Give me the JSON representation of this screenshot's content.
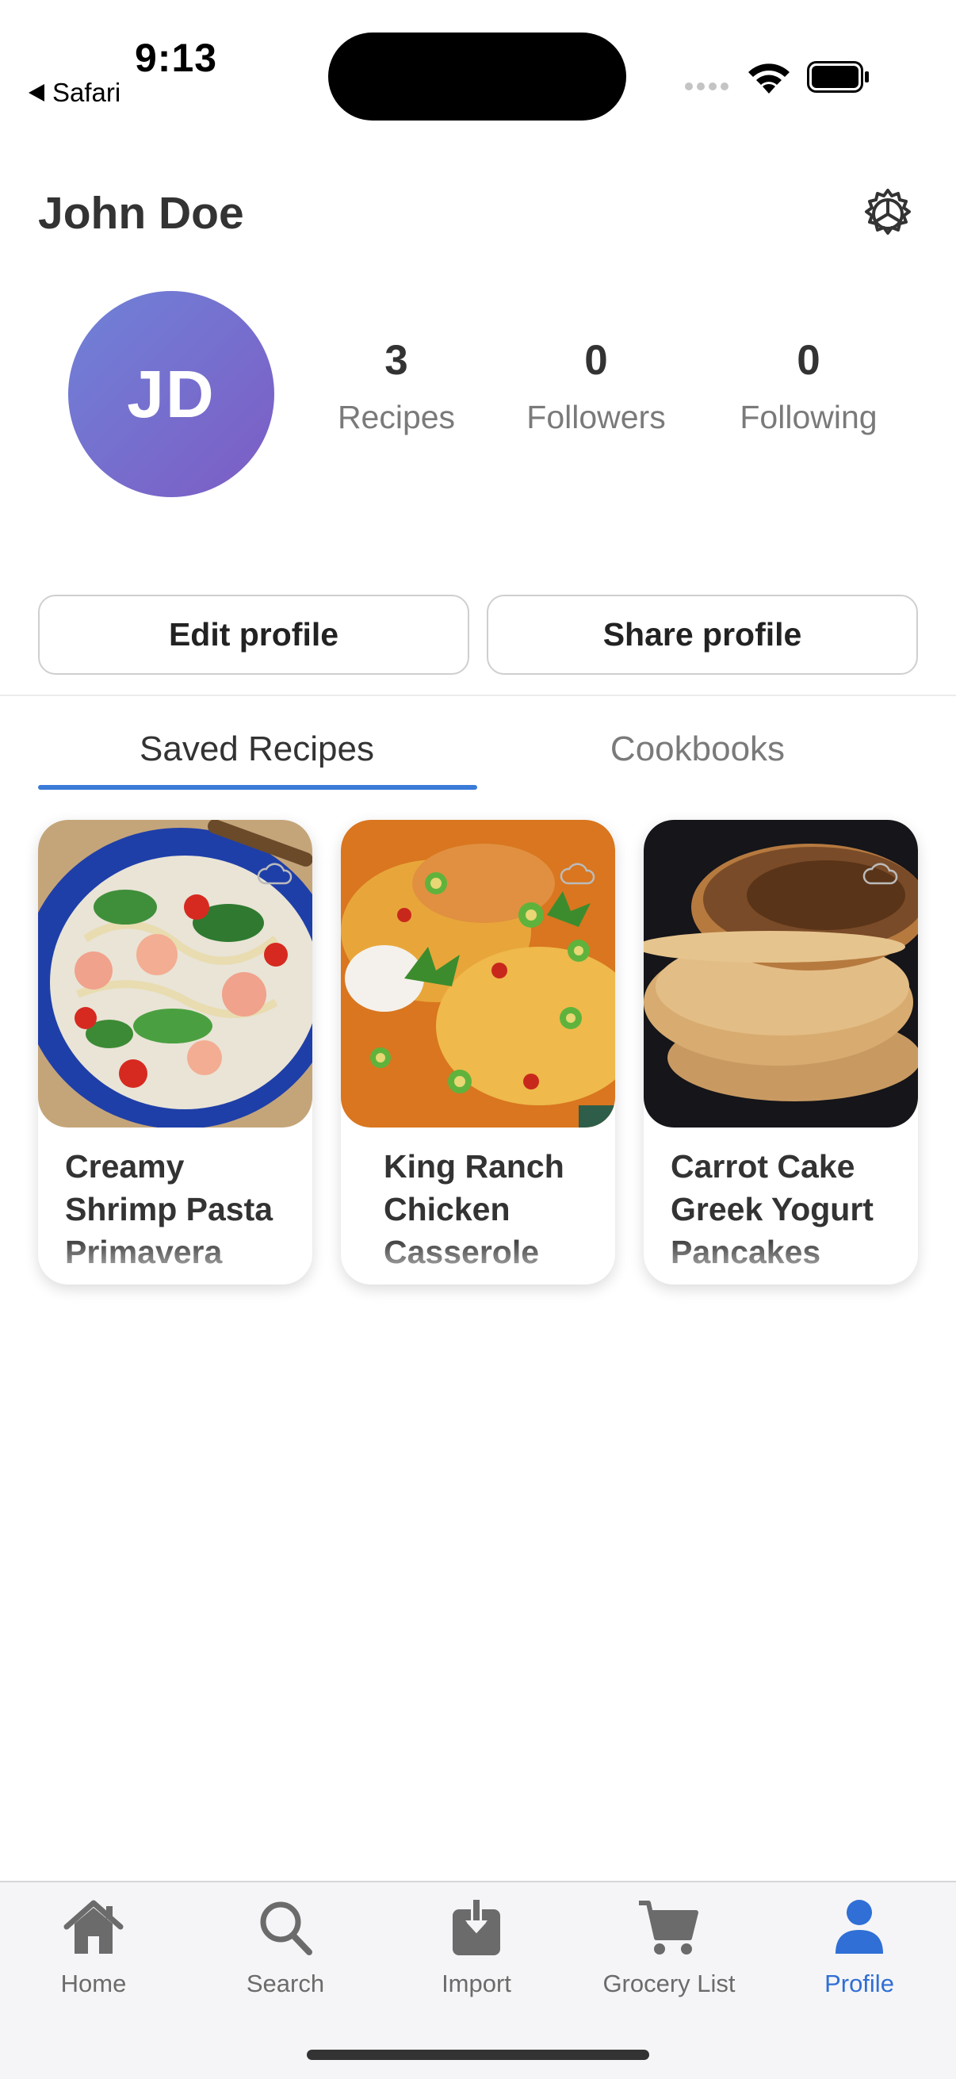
{
  "status_bar": {
    "time": "9:13",
    "back_app": "Safari"
  },
  "header": {
    "name": "John Doe",
    "settings_icon": "gear-icon"
  },
  "avatar": {
    "initials": "JD",
    "gradient": [
      "#6f82d8",
      "#7d5cc4"
    ]
  },
  "stats": [
    {
      "value": "3",
      "label": "Recipes"
    },
    {
      "value": "0",
      "label": "Followers"
    },
    {
      "value": "0",
      "label": "Following"
    }
  ],
  "actions": {
    "edit": "Edit profile",
    "share": "Share profile"
  },
  "tabs": [
    {
      "label": "Saved Recipes",
      "active": true
    },
    {
      "label": "Cookbooks",
      "active": false
    }
  ],
  "recipes": [
    {
      "title": "Creamy Shrimp Pasta Primavera",
      "image": "shrimp-pasta-photo"
    },
    {
      "title": "King Ranch Chicken Casserole",
      "image": "casserole-photo"
    },
    {
      "title": "Carrot Cake Greek Yogurt Pancakes",
      "image": "pancakes-photo"
    }
  ],
  "tab_bar": [
    {
      "label": "Home",
      "icon": "home-icon",
      "active": false
    },
    {
      "label": "Search",
      "icon": "search-icon",
      "active": false
    },
    {
      "label": "Import",
      "icon": "import-icon",
      "active": false
    },
    {
      "label": "Grocery List",
      "icon": "cart-icon",
      "active": false
    },
    {
      "label": "Profile",
      "icon": "person-icon",
      "active": true
    }
  ],
  "colors": {
    "accent": "#2f6fd6",
    "underline": "#3a7bd8",
    "muted_text": "#7a7a7a",
    "icon_inactive": "#6b6b6b"
  }
}
